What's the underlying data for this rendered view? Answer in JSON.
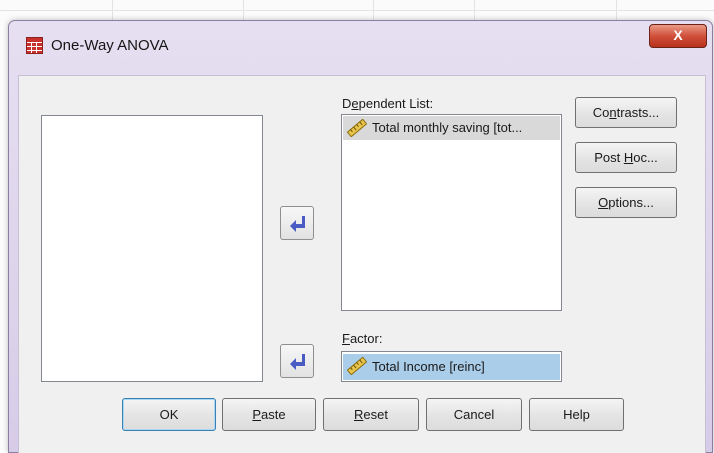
{
  "window": {
    "title": "One-Way ANOVA",
    "close_label": "X"
  },
  "dependent_list": {
    "label_prefix": "D",
    "label_mnemonic": "e",
    "label_suffix": "pendent List:",
    "items": [
      {
        "text": "Total monthly saving [tot...",
        "icon": "ruler-icon"
      }
    ]
  },
  "factor": {
    "label_mnemonic": "F",
    "label_suffix": "actor:",
    "value": "Total Income [reinc]",
    "icon": "ruler-icon"
  },
  "side_buttons": {
    "contrasts": {
      "pre": "Co",
      "mn": "n",
      "post": "trasts..."
    },
    "post_hoc": {
      "pre": "Post ",
      "mn": "H",
      "post": "oc..."
    },
    "options": {
      "pre": "",
      "mn": "O",
      "post": "ptions..."
    }
  },
  "bottom_buttons": {
    "ok": {
      "pre": "OK",
      "mn": "",
      "post": ""
    },
    "paste": {
      "pre": "",
      "mn": "P",
      "post": "aste"
    },
    "reset": {
      "pre": "",
      "mn": "R",
      "post": "eset"
    },
    "cancel": {
      "pre": "Cancel",
      "mn": "",
      "post": ""
    },
    "help": {
      "pre": "Help",
      "mn": "",
      "post": ""
    }
  },
  "colors": {
    "selection": "#aacde9",
    "arrow": "#4a5bc4"
  }
}
